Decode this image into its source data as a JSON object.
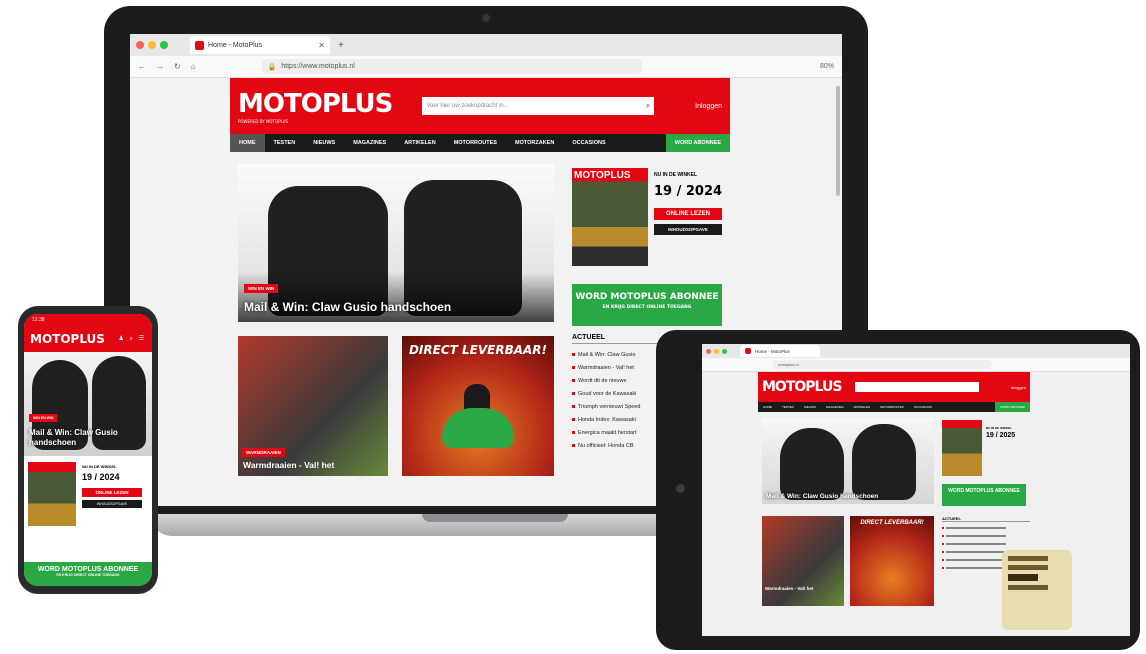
{
  "browser": {
    "tab_title": "Home - MotoPlus",
    "tab_close": "✕",
    "new_tab": "+",
    "url": "https://www.motoplus.nl",
    "zoom": "80%",
    "nav_back": "←",
    "nav_forward": "→",
    "nav_reload": "↻",
    "nav_home": "⌂"
  },
  "site": {
    "logo": "MOTOPLUS",
    "logo_tagline": "POWERED BY MOTOPLUS",
    "search_placeholder": "Voer hier uw zoekopdracht in...",
    "search_icon": "⌕",
    "login": "Inloggen",
    "nav": [
      "HOME",
      "TESTEN",
      "NIEUWS",
      "MAGAZINES",
      "ARTIKELEN",
      "MOTORROUTES",
      "MOTORZAKEN",
      "OCCASIONS"
    ],
    "nav_cta": "WORD ABONNEE"
  },
  "hero": {
    "tag": "WIN EN WIN",
    "title": "Mail & Win: Claw Gusio handschoen"
  },
  "magazine": {
    "cover_logo": "MOTOPLUS",
    "now_in_store": "NU IN DE WINKEL",
    "issue": "19 / 2024",
    "read_online": "ONLINE LEZEN",
    "contents": "INHOUDSOPGAVE"
  },
  "subscribe": {
    "title": "WORD MOTOPLUS ABONNEE",
    "subtitle": "EN KRIJG DIRECT ONLINE TOEGANG"
  },
  "cards": {
    "card1_tag": "WARMDRAAIEN",
    "card1_title": "Warmdraaien - Val! het",
    "card2_banner": "DIRECT LEVERBAAR!"
  },
  "actueel": {
    "heading": "ACTUEEL",
    "items": [
      "Mail & Win: Claw Gusio",
      "Warmdraaien - Val! het",
      "Wordt dit de nieuwe",
      "Goud voor de Kawasaki",
      "Triumph vernieuwt Speed",
      "Honda Index: Kawasaki",
      "Energica maakt herstart",
      "Nu officieel: Honda CB"
    ]
  },
  "phone": {
    "time": "12:38",
    "logo": "MOTOPLUS",
    "icons": "♟ ⌕ ☰",
    "hero_tag": "WIN EN WIN",
    "hero_title": "Mail & Win: Claw Gusio handschoen",
    "now_in_store": "NU IN DE WINKEL",
    "issue": "19 / 2024",
    "read_online": "ONLINE LEZEN",
    "contents": "INHOUDSOPGAVE",
    "cta": "WORD MOTOPLUS ABONNEE",
    "cta_sub": "EN KRIJG DIRECT ONLINE TOEGANG"
  },
  "tablet": {
    "tab_title": "Home - MotoPlus",
    "url": "motoplus.nl",
    "logo": "MOTOPLUS",
    "login": "Inloggen",
    "hero_title": "Mail & Win: Claw Gusio handschoen",
    "now_in_store": "NU IN DE WINKEL",
    "issue": "19 / 2025",
    "cta": "WORD MOTOPLUS ABONNEE",
    "card1_title": "Warmdraaien - Val! het",
    "card2_banner": "DIRECT LEVERBAAR!",
    "actueel": "ACTUEEL",
    "nav": [
      "HOME",
      "TESTEN",
      "NIEUWS",
      "MAGAZINES",
      "ARTIKELEN",
      "MOTORROUTES",
      "OCCASIONS"
    ],
    "nav_cta": "WORD ABONNEE"
  },
  "colors": {
    "brand_red": "#e30613",
    "cta_green": "#2aa845",
    "nav_dark": "#1a1a1a"
  }
}
